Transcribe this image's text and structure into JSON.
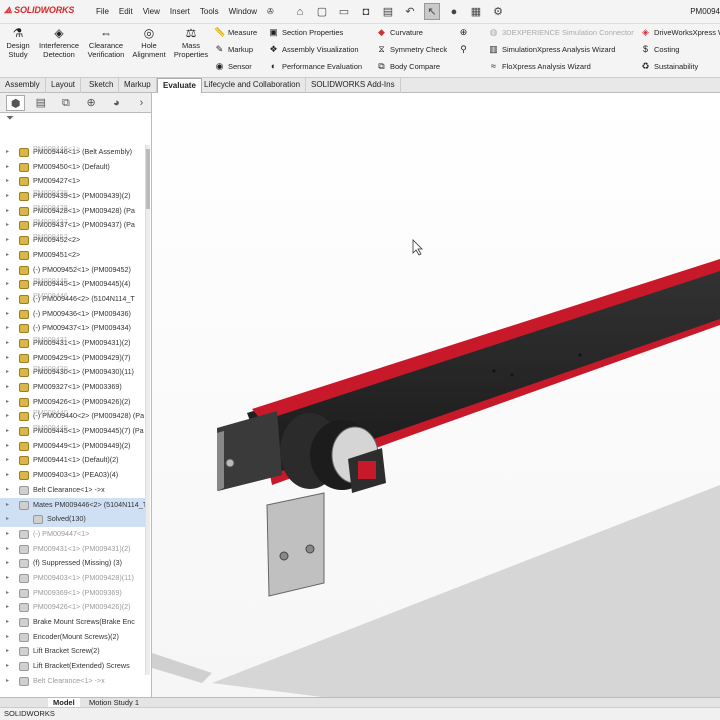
{
  "app": {
    "logo": "SOLIDWORKS",
    "title_right": "PM0094"
  },
  "menu": [
    "File",
    "Edit",
    "View",
    "Insert",
    "Tools",
    "Window"
  ],
  "quick_access": [
    "home-icon",
    "new-icon",
    "open-icon",
    "save-icon",
    "print-icon",
    "undo-icon",
    "select-icon",
    "traffic-light-icon",
    "grid-icon",
    "options-icon"
  ],
  "ribbon": {
    "design_study": "Design Study",
    "interference": "Interference Detection",
    "clearance": "Clearance Verification",
    "hole_alignment": "Hole Alignment",
    "mass_properties": "Mass Properties",
    "measure": "Measure",
    "markup": "Markup",
    "sensor": "Sensor",
    "section_properties": "Section Properties",
    "assembly_visualization": "Assembly Visualization",
    "performance_evaluation": "Performance Evaluation",
    "curvature": "Curvature",
    "symmetry_check": "Symmetry Check",
    "body_compare": "Body Compare",
    "experience_sim": "3DEXPERIENCE Simulation Connector",
    "simxpress": "SimulationXpress Analysis Wizard",
    "floxpress": "FloXpress Analysis Wizard",
    "driveworks": "DriveWorksXpress W",
    "costing": "Costing",
    "sustainability": "Sustainability"
  },
  "tabs": [
    "Assembly",
    "Layout",
    "Sketch",
    "Markup",
    "Evaluate",
    "Lifecycle and Collaboration",
    "SOLIDWORKS Add-Ins"
  ],
  "active_tab": "Evaluate",
  "tree": [
    {
      "label": "PM009446<1> (Belt Assembly)",
      "ghost": "PM009446<1>",
      "ico": "gold"
    },
    {
      "label": "PM009450<1> (Default)",
      "ghost": "",
      "ico": "gold"
    },
    {
      "label": "PM009427<1>",
      "ghost": "",
      "ico": "gold"
    },
    {
      "label": "PM009439<1> (PM009439)(2)",
      "ghost": "PM009439",
      "ico": "gold"
    },
    {
      "label": "PM009428<1> (PM009428) (Pa",
      "ghost": "PM009428",
      "ico": "gold"
    },
    {
      "label": "PM009437<1> (PM009437) (Pa",
      "ghost": "PM009437",
      "ico": "gold"
    },
    {
      "label": "PM009452<2>",
      "ghost": "PM009452",
      "ico": "gold"
    },
    {
      "label": "PM009451<2>",
      "ghost": "",
      "ico": "gold"
    },
    {
      "label": "(-) PM009452<1> (PM009452)",
      "ghost": "",
      "ico": "gold"
    },
    {
      "label": "PM009445<1> (PM009445)(4)",
      "ghost": "PM009445",
      "ico": "gold"
    },
    {
      "label": "(-) PM009446<2> (5104N114_T",
      "ghost": "PM009446",
      "ico": "gold"
    },
    {
      "label": "(-) PM009436<1> (PM009436)",
      "ghost": "",
      "ico": "gold"
    },
    {
      "label": "(-) PM009437<1> (PM009434)",
      "ghost": "",
      "ico": "gold"
    },
    {
      "label": "PM009431<1> (PM009431)(2)",
      "ghost": "PM009431",
      "ico": "gold"
    },
    {
      "label": "PM009429<1> (PM009429)(7)",
      "ghost": "",
      "ico": "gold"
    },
    {
      "label": "PM009430<1> (PM009430)(11)",
      "ghost": "PM009430",
      "ico": "gold"
    },
    {
      "label": "PM009327<1> (PM003369)",
      "ghost": "",
      "ico": "gold"
    },
    {
      "label": "PM009426<1> (PM009426)(2)",
      "ghost": "",
      "ico": "gold"
    },
    {
      "label": "(-) PM009440<2> (PM009428) (Pa",
      "ghost": "PM009440",
      "ico": "gold"
    },
    {
      "label": "PM009445<1> (PM009445)(7) (Pa",
      "ghost": "PM009445",
      "ico": "gold"
    },
    {
      "label": "PM009449<1> (PM009449)(2)",
      "ghost": "",
      "ico": "gold"
    },
    {
      "label": "PM009441<1> (Default)(2)",
      "ghost": "",
      "ico": "gold"
    },
    {
      "label": "PM009403<1> (PEA03)(4)",
      "ghost": "",
      "ico": "gold"
    },
    {
      "label": "Belt Clearance<1> ->x",
      "ghost": "",
      "ico": "gray"
    },
    {
      "label": "Mates  PM009446<2> (5104N114_T",
      "ghost": "",
      "ico": "gray",
      "sel": true
    },
    {
      "label": "Solved(130)",
      "ghost": "",
      "ico": "gray",
      "sel": true,
      "indent": true
    },
    {
      "label": "(-) PM009447<1>",
      "ghost": "",
      "ico": "gray",
      "dim": true
    },
    {
      "label": "PM009431<1> (PM009431)(2)",
      "ghost": "",
      "ico": "gray",
      "dim": true
    },
    {
      "label": "(f) Suppressed (Missing) (3)",
      "ghost": "",
      "ico": "gray"
    },
    {
      "label": "PM009403<1> (PM009428)(11)",
      "ghost": "",
      "ico": "gray",
      "dim": true
    },
    {
      "label": "PM009369<1> (PM009369)",
      "ghost": "",
      "ico": "gray",
      "dim": true
    },
    {
      "label": "PM009426<1> (PM009426)(2)",
      "ghost": "",
      "ico": "gray",
      "dim": true
    },
    {
      "label": "Brake Mount Screws(Brake Enc",
      "ghost": "",
      "ico": "gray"
    },
    {
      "label": "Encoder(Mount Screws)(2)",
      "ghost": "",
      "ico": "gray"
    },
    {
      "label": "Lift Bracket Screw(2)",
      "ghost": "",
      "ico": "gray"
    },
    {
      "label": "Lift Bracket(Extended) Screws",
      "ghost": "",
      "ico": "gray"
    },
    {
      "label": "Belt Clearance<1> ->x",
      "ghost": "",
      "ico": "gray",
      "dim": true
    }
  ],
  "bottom_tabs": [
    "Model",
    "Motion Study 1"
  ],
  "status": "SOLIDWORKS",
  "colors": {
    "accent_red": "#d8262b",
    "belt_red": "#c8192a",
    "frame_black": "#222222",
    "selection": "#cfe0f5"
  }
}
